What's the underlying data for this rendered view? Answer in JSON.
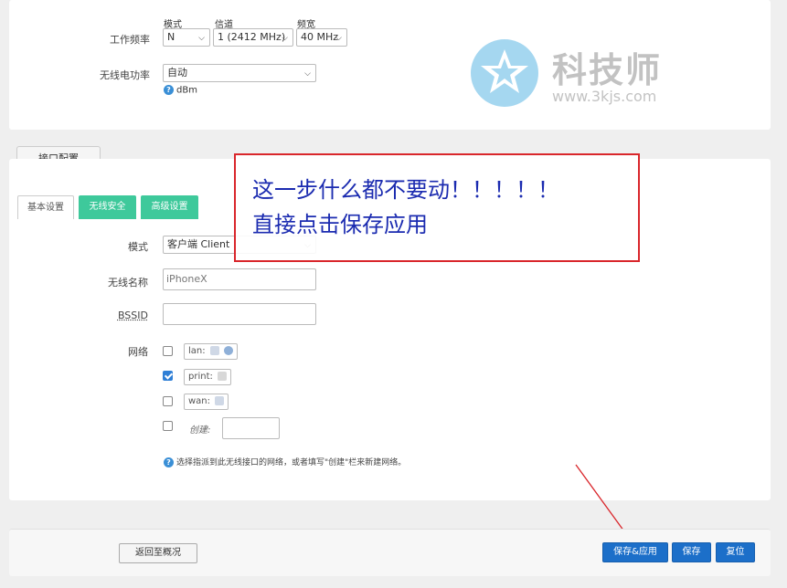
{
  "top_section": {
    "freq_label": "工作频率",
    "col_mode": "模式",
    "col_channel": "信道",
    "col_width": "频宽",
    "mode_value": "N",
    "channel_value": "1 (2412 MHz)",
    "width_value": "40 MHz",
    "power_label": "无线电功率",
    "power_value": "自动",
    "power_hint": "dBm"
  },
  "watermark": {
    "title": "科技师",
    "url": "www.3kjs.com"
  },
  "interface": {
    "tab_label": "接口配置",
    "subtabs": [
      "基本设置",
      "无线安全",
      "高级设置"
    ]
  },
  "form": {
    "mode_label": "模式",
    "mode_value": "客户端 Client",
    "ssid_label": "无线名称",
    "ssid_value": "iPhoneX",
    "bssid_label": "BSSID",
    "bssid_value": "",
    "network_label": "网络",
    "networks": [
      {
        "name": "lan:",
        "checked": false
      },
      {
        "name": "print:",
        "checked": true
      },
      {
        "name": "wan:",
        "checked": false
      }
    ],
    "create_label": "创建:",
    "network_hint": "选择指派到此无线接口的网络，或者填写\"创建\"栏来新建网络。"
  },
  "annotation": {
    "line1": "这一步什么都不要动！！！！！",
    "line2": "直接点击保存应用"
  },
  "footer": {
    "back_label": "返回至概况",
    "save_apply_label": "保存&应用",
    "save_label": "保存",
    "reset_label": "复位"
  },
  "colors": {
    "primary_button": "#1c6fc9",
    "green_tab": "#3ec99b",
    "annotation_border": "#d9262b",
    "annotation_text": "#1b2bb0"
  }
}
